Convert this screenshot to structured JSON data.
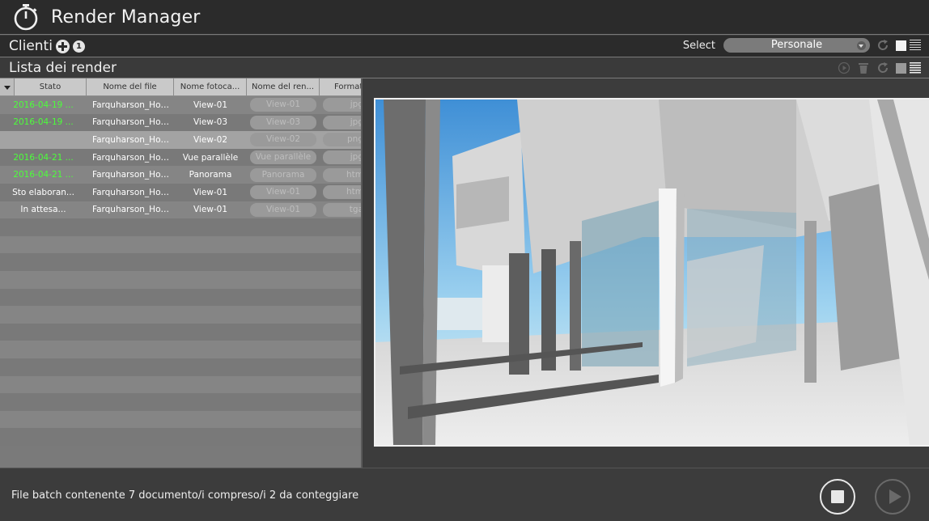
{
  "app": {
    "title": "Render Manager"
  },
  "clients": {
    "label": "Clienti",
    "count": "1"
  },
  "select": {
    "label": "Select",
    "value": "Personale"
  },
  "render_list": {
    "label": "Lista dei render"
  },
  "table": {
    "columns": [
      "Stato",
      "Nome del file",
      "Nome fotoca...",
      "Nome del ren...",
      "Format"
    ],
    "rows": [
      {
        "status": "2016-04-19 ...",
        "state": "done",
        "file": "Farquharson_House...",
        "photo": "View-01",
        "render": "View-01",
        "format": "jpg"
      },
      {
        "status": "2016-04-19 ...",
        "state": "done",
        "file": "Farquharson_House...",
        "photo": "View-03",
        "render": "View-03",
        "format": "jpg"
      },
      {
        "status": "",
        "state": "selected",
        "file": "Farquharson_House...",
        "photo": "View-02",
        "render": "View-02",
        "format": "png"
      },
      {
        "status": "2016-04-21 ...",
        "state": "done",
        "file": "Farquharson_House...",
        "photo": "Vue parallèle",
        "render": "Vue parallèle",
        "format": "jpg"
      },
      {
        "status": "2016-04-21 ...",
        "state": "done",
        "file": "Farquharson_House...",
        "photo": "Panorama",
        "render": "Panorama",
        "format": "htm"
      },
      {
        "status": "Sto elaboran...",
        "state": "processing",
        "file": "Farquharson_House...",
        "photo": "View-01",
        "render": "View-01",
        "format": "htm"
      },
      {
        "status": "In attesa...",
        "state": "waiting",
        "file": "Farquharson_House...",
        "photo": "View-01",
        "render": "View-01",
        "format": "tga"
      }
    ],
    "empty_rows": 13
  },
  "footer": {
    "status": "File batch contenente 7 documento/i compreso/i 2 da conteggiare"
  },
  "colors": {
    "done": "#4cff3a",
    "bar": "#2b2b2b",
    "panel": "#3c3c3c"
  },
  "icons": {
    "app": "stopwatch-icon",
    "add": "plus-circle-icon",
    "refresh": "refresh-icon",
    "trash": "trash-icon",
    "play_small": "play-circle-icon"
  }
}
